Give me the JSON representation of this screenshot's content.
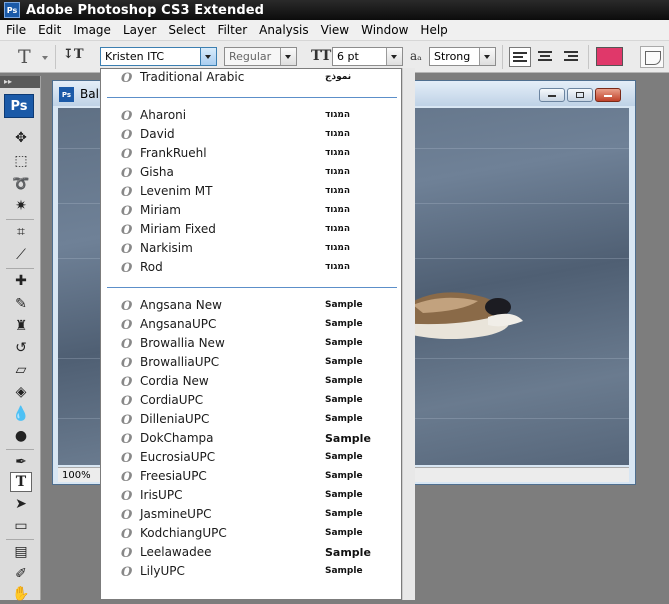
{
  "window": {
    "title": "Adobe Photoshop CS3 Extended",
    "app_badge": "Ps"
  },
  "menubar": [
    "File",
    "Edit",
    "Image",
    "Layer",
    "Select",
    "Filter",
    "Analysis",
    "View",
    "Window",
    "Help"
  ],
  "options": {
    "tool_preset_glyph": "T",
    "orientation_glyph": "↧T",
    "font_family": "Kristen ITC",
    "font_style": "Regular",
    "size_glyph": "TT",
    "font_size": "6 pt",
    "aa_glyph": "aₐ",
    "antialias": "Strong",
    "text_color": "#e0386a"
  },
  "toolbox": {
    "header": "▸▸",
    "logo": "Ps"
  },
  "document": {
    "title": "Balb",
    "badge": "Ps",
    "zoom": "100%"
  },
  "font_list": {
    "group_arabic": [
      {
        "name": "Traditional Arabic",
        "sample": "نموذج"
      }
    ],
    "group_hebrew": [
      {
        "name": "Aharoni",
        "sample": "המגוד"
      },
      {
        "name": "David",
        "sample": "המגוד"
      },
      {
        "name": "FrankRuehl",
        "sample": "המגוד"
      },
      {
        "name": "Gisha",
        "sample": "המגוד"
      },
      {
        "name": "Levenim MT",
        "sample": "המגוד"
      },
      {
        "name": "Miriam",
        "sample": "המגוד"
      },
      {
        "name": "Miriam Fixed",
        "sample": "המגוד"
      },
      {
        "name": "Narkisim",
        "sample": "המגוד"
      },
      {
        "name": "Rod",
        "sample": "המגוד"
      }
    ],
    "group_thai": [
      {
        "name": "Angsana New",
        "sample": "Sample"
      },
      {
        "name": "AngsanaUPC",
        "sample": "Sample"
      },
      {
        "name": "Browallia New",
        "sample": "Sample"
      },
      {
        "name": "BrowalliaUPC",
        "sample": "Sample"
      },
      {
        "name": "Cordia New",
        "sample": "Sample"
      },
      {
        "name": "CordiaUPC",
        "sample": "Sample"
      },
      {
        "name": "DilleniaUPC",
        "sample": "Sample"
      },
      {
        "name": "DokChampa",
        "sample": "Sample"
      },
      {
        "name": "EucrosiaUPC",
        "sample": "Sample"
      },
      {
        "name": "FreesiaUPC",
        "sample": "Sample"
      },
      {
        "name": "IrisUPC",
        "sample": "Sample"
      },
      {
        "name": "JasmineUPC",
        "sample": "Sample"
      },
      {
        "name": "KodchiangUPC",
        "sample": "Sample"
      },
      {
        "name": "Leelawadee",
        "sample": "Sample"
      },
      {
        "name": "LilyUPC",
        "sample": "Sample"
      }
    ]
  }
}
